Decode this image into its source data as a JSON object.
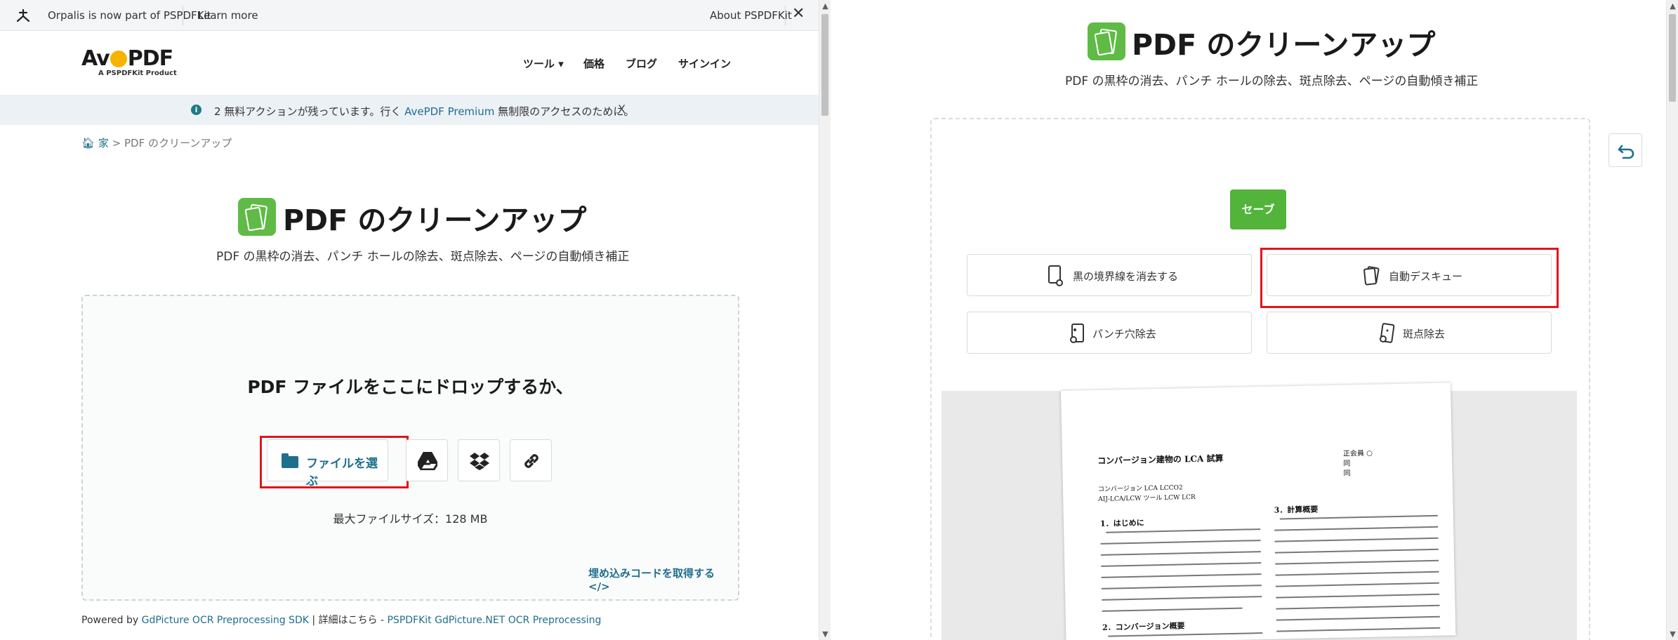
{
  "left": {
    "topbar": {
      "message": "Orpalis is now part of PSPDFKit",
      "learn_more": "Learn more",
      "about": "About PSPDFKit"
    },
    "brand": {
      "name_a": "Av",
      "name_b": "PDF",
      "tagline": "A PSPDFKit Product"
    },
    "nav": {
      "tools": "ツール ▾",
      "pricing": "価格",
      "blog": "ブログ",
      "signin": "サインイン"
    },
    "notice": {
      "before": "2 無料アクションが残っています。行く ",
      "link": "AvePDF Premium",
      "after": " 無制限のアクセスのために。",
      "close": "X"
    },
    "breadcrumb": {
      "home": "家",
      "separator": ">",
      "current": "PDF のクリーンアップ"
    },
    "hero": {
      "title": "PDF のクリーンアップ",
      "subtitle": "PDF の黒枠の消去、パンチ ホールの除去、斑点除去、ページの自動傾き補正"
    },
    "dropzone": {
      "drop_text": "PDF ファイルをここにドロップするか、",
      "choose_file": "ファイルを選ぶ",
      "max_size": "最大ファイルサイズ：128 MB",
      "embed": "埋め込みコードを取得する </>"
    },
    "footer": {
      "powered_by": "Powered by ",
      "sdk_link": "GdPicture OCR Preprocessing SDK",
      "middle": " | 詳細はこちら - ",
      "net_link": "PSPDFKit GdPicture.NET OCR Preprocessing"
    }
  },
  "right": {
    "hero": {
      "title": "PDF のクリーンアップ",
      "subtitle": "PDF の黒枠の消去、パンチ ホールの除去、斑点除去、ページの自動傾き補正"
    },
    "save": "セーブ",
    "options": {
      "border": "黒の境界線を消去する",
      "deskew": "自動デスキュー",
      "punch": "パンチ穴除去",
      "despeckle": "斑点除去"
    },
    "document": {
      "heading": "コンバージョン建物の LCA 試算",
      "section1": "1．はじめに",
      "section2": "2．コンバージョン概要",
      "section3": "3．計算概要",
      "meta": "正会員 ○\n同\n同",
      "note": "コンバージョン LCA LCCO2\nAIJ-LCA/LCW ツール LCW LCR"
    }
  },
  "colors": {
    "accent_green": "#52b43b",
    "link_teal": "#1f6e8c",
    "highlight_red": "#e3141b"
  }
}
